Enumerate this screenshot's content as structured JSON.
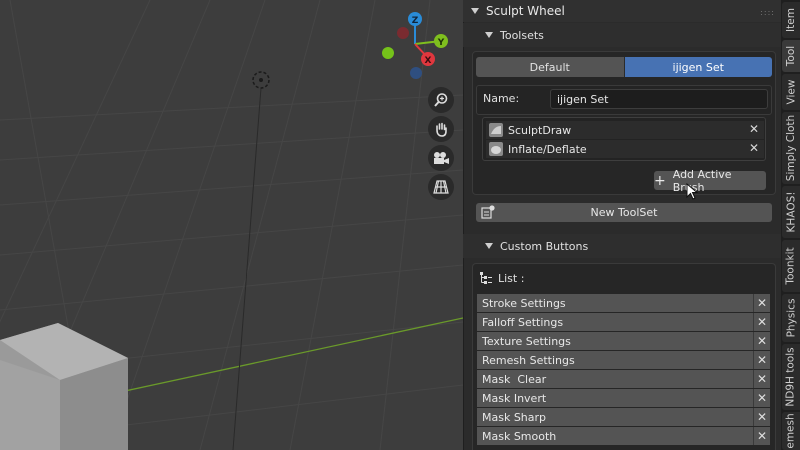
{
  "panel": {
    "title": "Sculpt Wheel",
    "toolsets": {
      "title": "Toolsets",
      "tabs": [
        "Default",
        "ijigen Set"
      ],
      "active_tab": 1,
      "name_label": "Name:",
      "name_value": "ijigen Set",
      "brushes": [
        "SculptDraw",
        "Inflate/Deflate"
      ],
      "add_button": "Add Active Brush",
      "new_button": "New ToolSet"
    },
    "custom_buttons": {
      "title": "Custom Buttons",
      "list_label": "List :",
      "items": [
        "Stroke Settings",
        "Falloff Settings",
        "Texture Settings",
        "Remesh Settings",
        "Mask  Clear",
        "Mask Invert",
        "Mask Sharp",
        "Mask Smooth"
      ]
    },
    "remove_glyph": "✕",
    "add_glyph": "+"
  },
  "tabs": [
    "Item",
    "Tool",
    "View",
    "Simply Cloth",
    "KHAOS!",
    "Toonkit",
    "Physics",
    "ND9H tools",
    "emesh"
  ],
  "gizmo": {
    "z": "Z",
    "y": "Y",
    "x": "X"
  },
  "colors": {
    "accent": "#4772b3",
    "x_axis": "#e0373e",
    "y_axis": "#7fbf1e",
    "z_axis": "#2a8cd8",
    "panel_bg": "#2b2b2b",
    "viewport_bg": "#3d3d3d"
  },
  "icons": [
    "zoom-icon",
    "hand-icon",
    "camera-icon",
    "grid-icon",
    "cursor-icon",
    "brush-icon",
    "new-toolset-icon",
    "list-icon"
  ]
}
